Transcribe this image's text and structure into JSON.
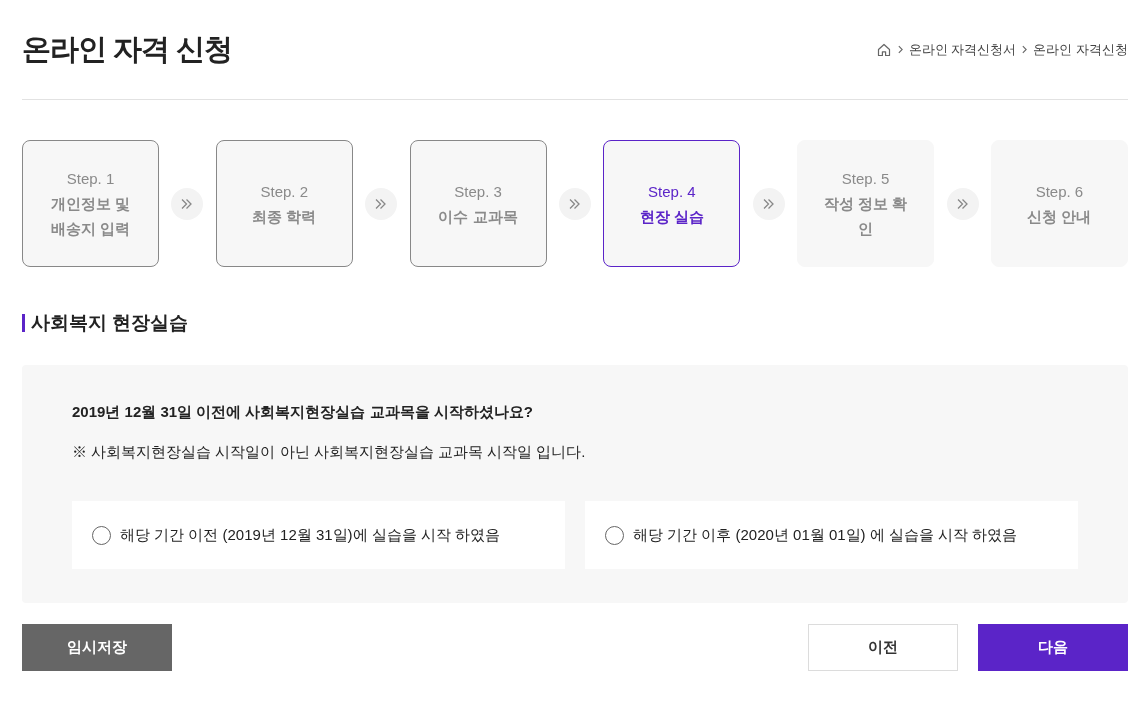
{
  "page": {
    "title": "온라인 자격 신청"
  },
  "breadcrumb": [
    "온라인 자격신청서",
    "온라인 자격신청"
  ],
  "steps": [
    {
      "step": "Step. 1",
      "label": "개인정보 및 배송지 입력",
      "completed": true,
      "selected": false
    },
    {
      "step": "Step. 2",
      "label": "최종 학력",
      "completed": true,
      "selected": false
    },
    {
      "step": "Step. 3",
      "label": "이수 교과목",
      "completed": true,
      "selected": false
    },
    {
      "step": "Step. 4",
      "label": "현장 실습",
      "completed": false,
      "selected": true
    },
    {
      "step": "Step. 5",
      "label": "작성 정보 확인",
      "completed": false,
      "selected": false
    },
    {
      "step": "Step. 6",
      "label": "신청 안내",
      "completed": false,
      "selected": false
    }
  ],
  "section": {
    "title": "사회복지 현장실습",
    "question": "2019년 12월 31일 이전에 사회복지현장실습 교과목을 시작하셨나요?",
    "note": "※ 사회복지현장실습 시작일이 아닌 사회복지현장실습 교과목 시작일 입니다.",
    "options": [
      {
        "label": "해당 기간 이전 (2019년 12월 31일)에 실습을 시작 하였음",
        "selected": false
      },
      {
        "label": "해당 기간 이후 (2020년 01월 01일) 에 실습을 시작 하였음",
        "selected": false
      }
    ]
  },
  "buttons": [
    {
      "label": "임시저장",
      "kind": "save"
    },
    {
      "label": "이전",
      "kind": "prev"
    },
    {
      "label": "다음",
      "kind": "next"
    }
  ]
}
